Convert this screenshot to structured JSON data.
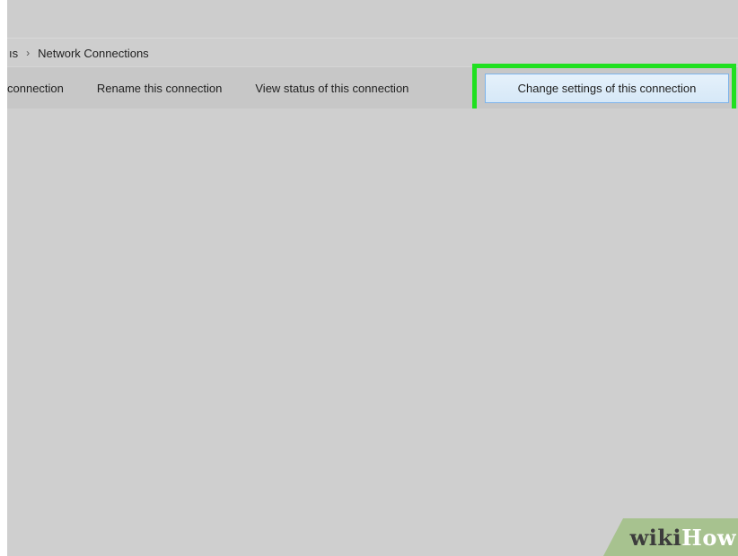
{
  "address_bar": {
    "prev_crumb": "ıs",
    "separator": "›",
    "current": "Network Connections"
  },
  "command_bar": {
    "delete_label": "connection",
    "rename_label": "Rename this connection",
    "status_label": "View status of this connection",
    "change_label": "Change settings of this connection"
  },
  "watermark": {
    "wiki": "wiki",
    "how": "How"
  },
  "colors": {
    "highlight": "#20e020",
    "button_hover": "#e5f1fb",
    "background": "#cfcfcf",
    "watermark_bg": "#a7c28f"
  }
}
